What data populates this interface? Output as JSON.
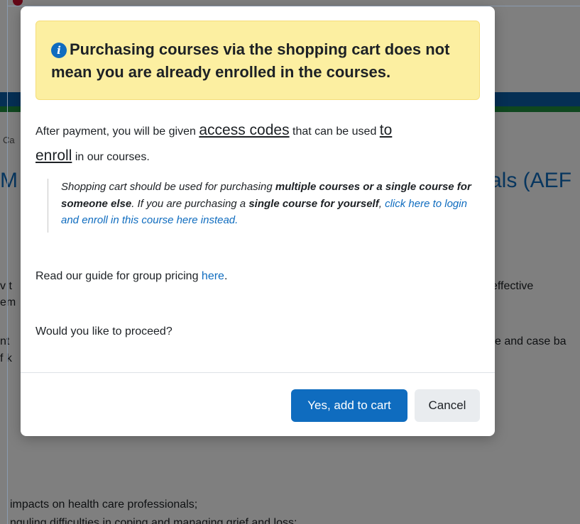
{
  "background": {
    "breadcrumb_fragment": "Ca",
    "title_left_fragment": "M",
    "title_right_fragment": "als (AEF",
    "text_right_1": "effective",
    "text_left_1": "v t",
    "text_left_2": "em",
    "text_right_2": "e and case ba",
    "text_left_3": "nt",
    "text_left_4": "f k",
    "text_bottom_1": "impacts on health care professionals;",
    "text_bottom_2": "nguling difficulties in coping and managing grief and loss;"
  },
  "modal": {
    "alert_icon": "info-icon",
    "alert_text": "Purchasing courses via the shopping cart does not mean you are already enrolled in the courses.",
    "para1_prefix": "After payment, you will be given ",
    "para1_access_codes": "access codes",
    "para1_middle": " that can be used ",
    "para1_to": "to",
    "para1_enroll": "enroll",
    "para1_suffix": " in our courses.",
    "quote_part1": "Shopping cart should be used for purchasing ",
    "quote_bold1": "multiple courses or a single course for someone else",
    "quote_part2": ". If you are purchasing a ",
    "quote_bold2": "single course for yourself",
    "quote_part3": ", ",
    "quote_link": "click here to login and enroll in this course here instead.",
    "para2_text": "Read our guide for group pricing ",
    "para2_link": "here",
    "para2_end": ".",
    "para3_text": "Would you like to proceed?",
    "confirm_button": "Yes, add to cart",
    "cancel_button": "Cancel"
  },
  "colors": {
    "primary": "#0f6cbf",
    "alert_bg": "#fcefa1",
    "overlay": "rgba(0,0,0,0.5)"
  }
}
